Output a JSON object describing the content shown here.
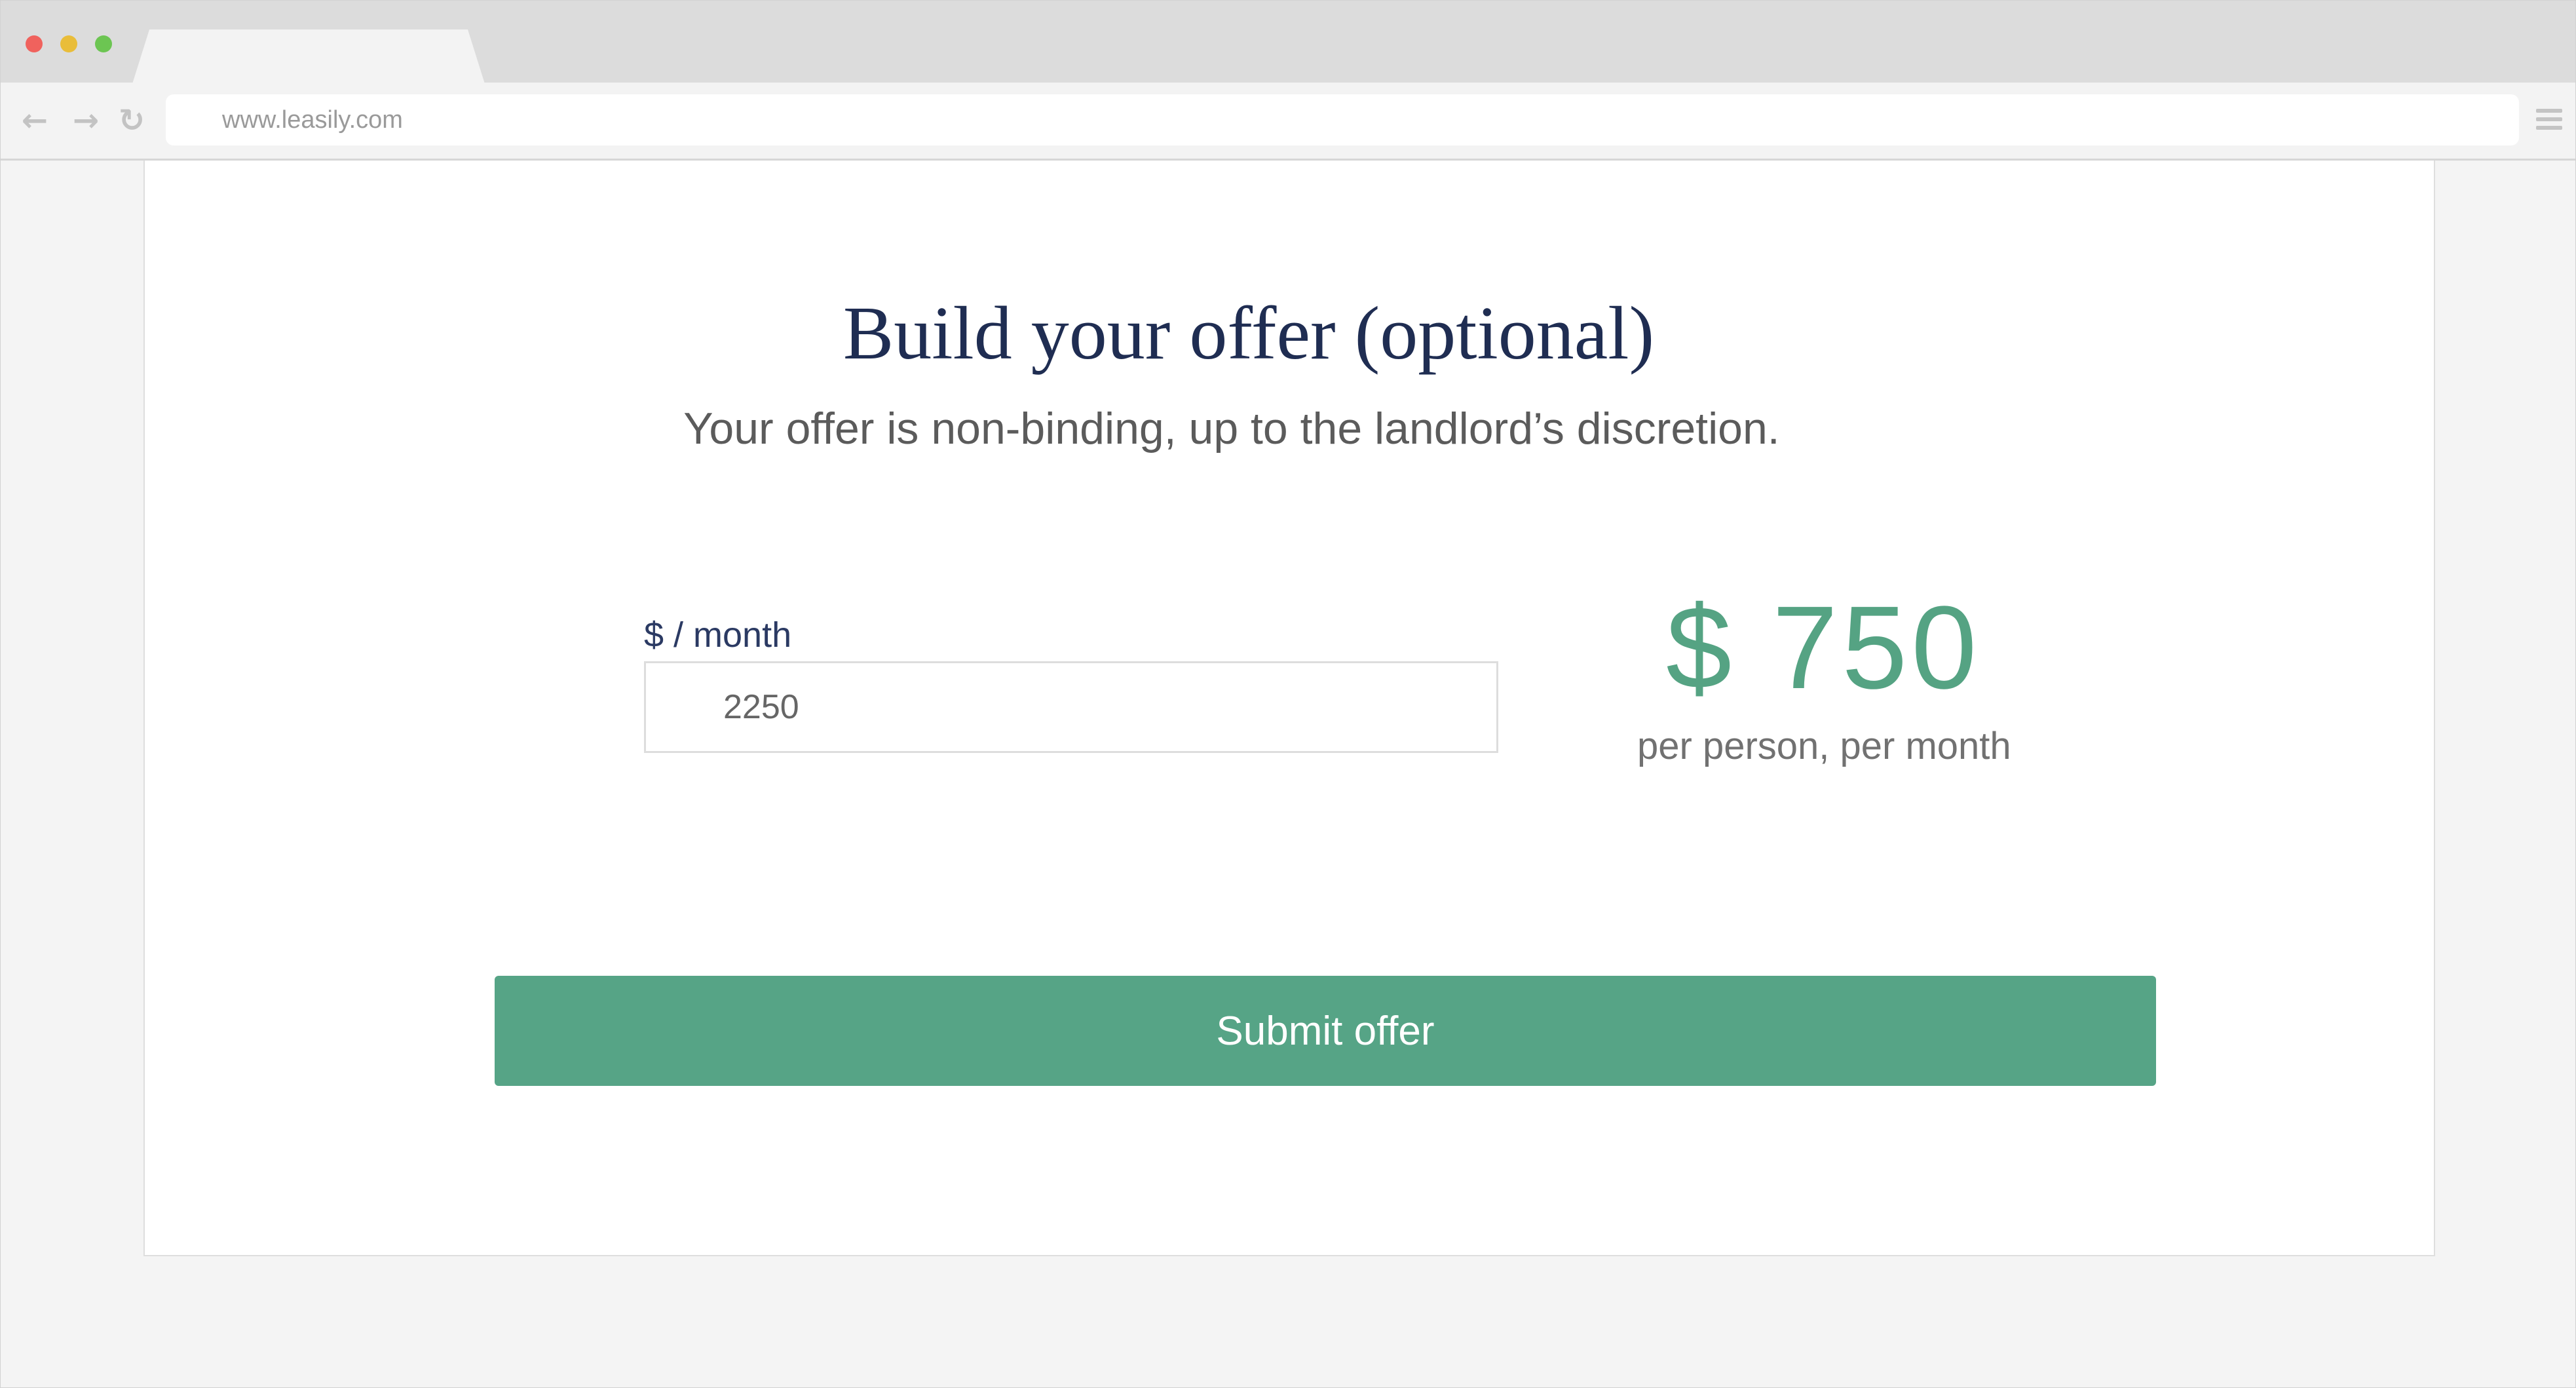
{
  "browser": {
    "url": "www.leasily.com",
    "icons": {
      "back": "arrow-left-icon",
      "forward": "arrow-right-icon",
      "reload": "reload-icon",
      "menu": "hamburger-menu-icon"
    }
  },
  "offer": {
    "title": "Build your offer (optional)",
    "subtitle": "Your offer is non-binding, up to the landlord’s discretion.",
    "rent_label": "$ / month",
    "rent_value": "2250",
    "per_person_amount": "$ 750",
    "per_person_caption": "per person, per month",
    "submit_label": "Submit offer"
  },
  "colors": {
    "accent": "#56a486",
    "title": "#1f2d52"
  }
}
